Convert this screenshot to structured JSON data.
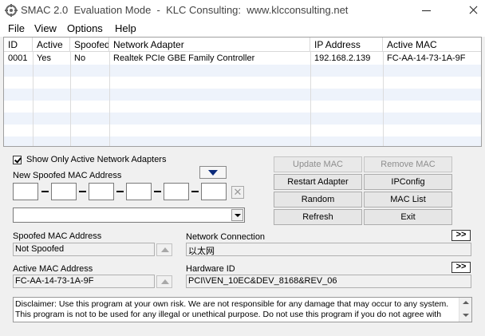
{
  "window": {
    "title": "SMAC 2.0  Evaluation Mode  -  KLC Consulting:  www.klcconsulting.net"
  },
  "menu": {
    "items": [
      "File",
      "View",
      "Options",
      "Help"
    ]
  },
  "adapters_table": {
    "columns": [
      "ID",
      "Active",
      "Spoofed",
      "Network Adapter",
      "IP Address",
      "Active MAC"
    ],
    "rows": [
      {
        "id": "0001",
        "active": "Yes",
        "spoofed": "No",
        "adapter": "Realtek PCIe GBE Family Controller",
        "ip": "192.168.2.139",
        "mac": "FC-AA-14-73-1A-9F"
      }
    ]
  },
  "options": {
    "show_only_active_label": "Show Only Active Network Adapters",
    "show_only_active_checked": true
  },
  "new_mac": {
    "label": "New Spoofed MAC Address",
    "octets": [
      "",
      "",
      "",
      "",
      "",
      ""
    ],
    "combo_value": ""
  },
  "actions": {
    "update_mac": "Update MAC",
    "remove_mac": "Remove MAC",
    "restart_adapter": "Restart Adapter",
    "ipconfig": "IPConfig",
    "random": "Random",
    "mac_list": "MAC List",
    "refresh": "Refresh",
    "exit": "Exit"
  },
  "info": {
    "spoofed_mac_label": "Spoofed MAC Address",
    "spoofed_mac_value": "Not Spoofed",
    "active_mac_label": "Active MAC Address",
    "active_mac_value": "FC-AA-14-73-1A-9F",
    "network_connection_label": "Network Connection",
    "network_connection_value": "以太网",
    "hardware_id_label": "Hardware ID",
    "hardware_id_value": "PCI\\VEN_10EC&DEV_8168&REV_06",
    "more_label": ">>"
  },
  "disclaimer": {
    "line1": "Disclaimer: Use this program at your own risk.  We are not responsible for any damage that may occur to any system.",
    "line2": "This program is not to be used for any illegal or unethical purpose.  Do not use this program if you do not agree with"
  },
  "colors": {
    "window_bg": "#f0f0f0",
    "list_stripe": "#eef3fb",
    "arrow_blue": "#0b2a7a"
  }
}
